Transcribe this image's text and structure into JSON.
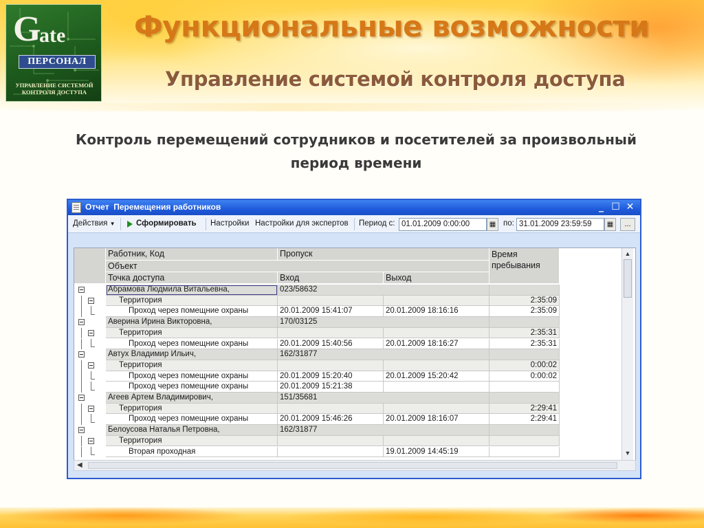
{
  "slide": {
    "title": "Функциональные возможности",
    "subtitle": "Управление системой контроля доступа",
    "caption_line1": "Контроль перемещений сотрудников и посетителей за произвольный",
    "caption_line2": "период времени"
  },
  "logo": {
    "big_letter": "G",
    "rest": "ate",
    "personal": "ПЕРСОНАЛ",
    "caption_line1": "УПРАВЛЕНИЕ СИСТЕМОЙ",
    "caption_line2": "КОНТРОЛЯ ДОСТУПА"
  },
  "window": {
    "title": "Отчет  Перемещения работников",
    "buttons": {
      "minimize": "_",
      "maximize": "☐",
      "close": "✕"
    }
  },
  "toolbar": {
    "actions": "Действия",
    "generate": "Сформировать",
    "settings": "Настройки",
    "expert_settings": "Настройки для экспертов",
    "period_from_label": "Период с:",
    "period_from_value": "01.01.2009  0:00:00",
    "period_to_label": "по:",
    "period_to_value": "31.01.2009 23:59:59",
    "more": "..."
  },
  "grid": {
    "headers": {
      "worker": "Работник, Код",
      "pass": "Пропуск",
      "stay_time_line1": "Время",
      "stay_time_line2": "пребывания",
      "object": "Объект",
      "access_point": "Точка доступа",
      "entry": "Вход",
      "exit": "Выход"
    },
    "rows": [
      {
        "level": 0,
        "name": "Абрамова Людмила Витальевна,",
        "entry": "023/58632",
        "exit": "",
        "time": ""
      },
      {
        "level": 1,
        "name": "Территория",
        "entry": "",
        "exit": "",
        "time": "2:35:09"
      },
      {
        "level": 2,
        "name": "Проход через помещние охраны",
        "entry": "20.01.2009 15:41:07",
        "exit": "20.01.2009 18:16:16",
        "time": "2:35:09"
      },
      {
        "level": 0,
        "name": "Аверина Ирина Викторовна,",
        "entry": "170/03125",
        "exit": "",
        "time": ""
      },
      {
        "level": 1,
        "name": "Территория",
        "entry": "",
        "exit": "",
        "time": "2:35:31"
      },
      {
        "level": 2,
        "name": "Проход через помещние охраны",
        "entry": "20.01.2009 15:40:56",
        "exit": "20.01.2009 18:16:27",
        "time": "2:35:31"
      },
      {
        "level": 0,
        "name": "Автух Владимир Ильич,",
        "entry": "162/31877",
        "exit": "",
        "time": ""
      },
      {
        "level": 1,
        "name": "Территория",
        "entry": "",
        "exit": "",
        "time": "0:00:02"
      },
      {
        "level": 2,
        "name": "Проход через помещние охраны",
        "entry": "20.01.2009 15:20:40",
        "exit": "20.01.2009 15:20:42",
        "time": "0:00:02"
      },
      {
        "level": 2,
        "name": "Проход через помещние охраны",
        "entry": "20.01.2009 15:21:38",
        "exit": "",
        "time": ""
      },
      {
        "level": 0,
        "name": "Агеев Артем Владимирович,",
        "entry": "151/35681",
        "exit": "",
        "time": ""
      },
      {
        "level": 1,
        "name": "Территория",
        "entry": "",
        "exit": "",
        "time": "2:29:41"
      },
      {
        "level": 2,
        "name": "Проход через помещние охраны",
        "entry": "20.01.2009 15:46:26",
        "exit": "20.01.2009 18:16:07",
        "time": "2:29:41"
      },
      {
        "level": 0,
        "name": "Белоусова Наталья Петровна,",
        "entry": "162/31877",
        "exit": "",
        "time": ""
      },
      {
        "level": 1,
        "name": "Территория",
        "entry": "",
        "exit": "",
        "time": ""
      },
      {
        "level": 2,
        "name": "Вторая проходная",
        "entry": "",
        "exit": "19.01.2009 14:45:19",
        "time": ""
      }
    ]
  }
}
